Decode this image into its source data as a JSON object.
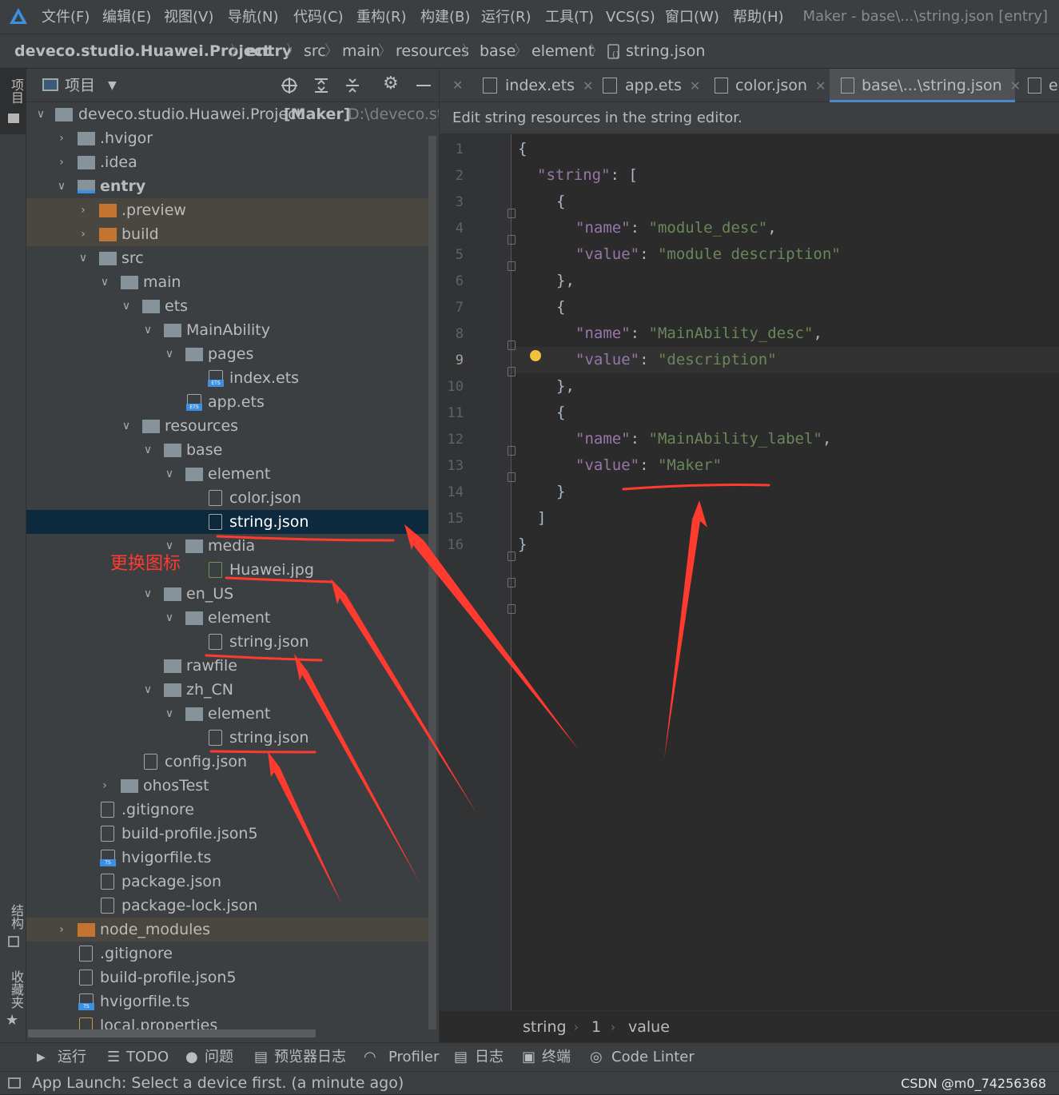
{
  "menubar": {
    "items": [
      "文件(F)",
      "编辑(E)",
      "视图(V)",
      "导航(N)",
      "代码(C)",
      "重构(R)",
      "构建(B)",
      "运行(R)",
      "工具(T)",
      "VCS(S)",
      "窗口(W)",
      "帮助(H)"
    ],
    "window_title": "Maker - base\\...\\string.json [entry]"
  },
  "breadcrumb": [
    "deveco.studio.Huawei.Project",
    "entry",
    "src",
    "main",
    "resources",
    "base",
    "element",
    "string.json"
  ],
  "left_strip": {
    "project": "项目",
    "structure": "结构",
    "favorites": "收藏夹"
  },
  "project_panel": {
    "title": "项目",
    "tree": [
      {
        "label": "deveco.studio.Huawei.Project",
        "suffix": "[Maker]",
        "path": "D:\\deveco.stu"
      },
      {
        "label": ".hvigor"
      },
      {
        "label": ".idea"
      },
      {
        "label": "entry"
      },
      {
        "label": ".preview"
      },
      {
        "label": "build"
      },
      {
        "label": "src"
      },
      {
        "label": "main"
      },
      {
        "label": "ets"
      },
      {
        "label": "MainAbility"
      },
      {
        "label": "pages"
      },
      {
        "label": "index.ets"
      },
      {
        "label": "app.ets"
      },
      {
        "label": "resources"
      },
      {
        "label": "base"
      },
      {
        "label": "element"
      },
      {
        "label": "color.json"
      },
      {
        "label": "string.json"
      },
      {
        "label": "media"
      },
      {
        "label": "Huawei.jpg"
      },
      {
        "label": "en_US"
      },
      {
        "label": "element"
      },
      {
        "label": "string.json"
      },
      {
        "label": "rawfile"
      },
      {
        "label": "zh_CN"
      },
      {
        "label": "element"
      },
      {
        "label": "string.json"
      },
      {
        "label": "config.json"
      },
      {
        "label": "ohosTest"
      },
      {
        "label": ".gitignore"
      },
      {
        "label": "build-profile.json5"
      },
      {
        "label": "hvigorfile.ts"
      },
      {
        "label": "package.json"
      },
      {
        "label": "package-lock.json"
      },
      {
        "label": "node_modules"
      },
      {
        "label": ".gitignore"
      },
      {
        "label": "build-profile.json5"
      },
      {
        "label": "hvigorfile.ts"
      },
      {
        "label": "local.properties"
      }
    ]
  },
  "tabs": [
    "index.ets",
    "app.ets",
    "color.json",
    "base\\...\\string.json",
    "er"
  ],
  "editor_notice": "Edit string resources in the string editor.",
  "code": {
    "line_numbers": [
      "1",
      "2",
      "3",
      "4",
      "5",
      "6",
      "7",
      "8",
      "9",
      "10",
      "11",
      "12",
      "13",
      "14",
      "15",
      "16"
    ],
    "k_string": "\"string\"",
    "k_name": "\"name\"",
    "k_value": "\"value\"",
    "v1_name": "\"module_desc\"",
    "v1_value": "\"module description\"",
    "v2_name": "\"MainAbility_desc\"",
    "v2_value": "\"description\"",
    "v3_name": "\"MainAbility_label\"",
    "v3_value": "\"Maker\""
  },
  "editor_breadcrumb": [
    "string",
    "1",
    "value"
  ],
  "toolbar": [
    "运行",
    "TODO",
    "问题",
    "预览器日志",
    "Profiler",
    "日志",
    "终端",
    "Code Linter"
  ],
  "status": {
    "message": "App Launch: Select a device first. (a minute ago)",
    "watermark": "CSDN @m0_74256368"
  },
  "annotation": {
    "label": "更换图标",
    "color": "#ff3b30"
  }
}
